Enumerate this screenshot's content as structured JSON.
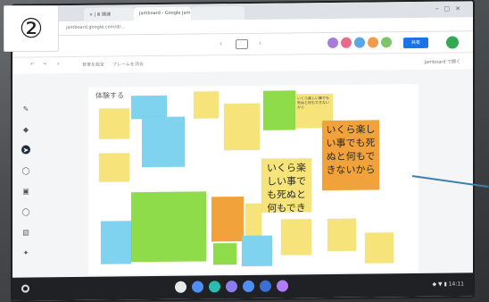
{
  "marker": {
    "label": "②"
  },
  "browser": {
    "tabs": [
      {
        "label": "× | Ⅲ 関連",
        "active": false
      },
      {
        "label": "Jamboard - Google Jam",
        "active": true
      },
      {
        "label": "",
        "active": false
      }
    ],
    "url": "jamboard.google.com/d/..."
  },
  "app": {
    "share_label": "共有",
    "toolbar": [
      "↶",
      "↷",
      "⌖",
      "背景を設定",
      "フレームを消去"
    ],
    "jamboard_label": "Jamboard で開く",
    "avatar_colors": [
      "#a77bd8",
      "#e56b8f",
      "#5aa7e8",
      "#f29b4b",
      "#7cc56b"
    ]
  },
  "tools": [
    "✎",
    "◆",
    "➤",
    "◯",
    "▣",
    "◯",
    "▤",
    "✦"
  ],
  "board": {
    "title": "体験する",
    "notes": [
      {
        "id": "n1",
        "color": "yellow",
        "size": "small",
        "text": ""
      },
      {
        "id": "n2",
        "color": "blue",
        "size": "small",
        "text": ""
      },
      {
        "id": "n3",
        "color": "yellow",
        "size": "small",
        "text": ""
      },
      {
        "id": "n4",
        "color": "yellow",
        "size": "small",
        "text": ""
      },
      {
        "id": "n5",
        "color": "green",
        "size": "small",
        "text": ""
      },
      {
        "id": "n6",
        "color": "yellow",
        "size": "small",
        "text": ""
      },
      {
        "id": "n7",
        "color": "orange",
        "size": "big",
        "text": ""
      },
      {
        "id": "n8",
        "color": "yellow",
        "size": "big",
        "text": "いくら楽しい事でも死ぬと何もできないから"
      },
      {
        "id": "n9",
        "color": "green",
        "size": "med",
        "text": ""
      },
      {
        "id": "n10",
        "color": "blue",
        "size": "small",
        "text": ""
      },
      {
        "id": "n11",
        "color": "orange",
        "size": "small",
        "text": ""
      },
      {
        "id": "n12",
        "color": "yellow",
        "size": "small",
        "text": ""
      },
      {
        "id": "n13",
        "color": "blue",
        "size": "small",
        "text": ""
      },
      {
        "id": "n14",
        "color": "yellow",
        "size": "small",
        "text": ""
      }
    ]
  },
  "taskbar": {
    "shelf_colors": [
      "#e8e8e8",
      "#4f8ef7",
      "#2bbcb0",
      "#8c7cf0",
      "#4f8ef7",
      "#3b6fd6",
      "#b07cf7"
    ],
    "tray": "◆ ▼ ▮ 14:11"
  }
}
